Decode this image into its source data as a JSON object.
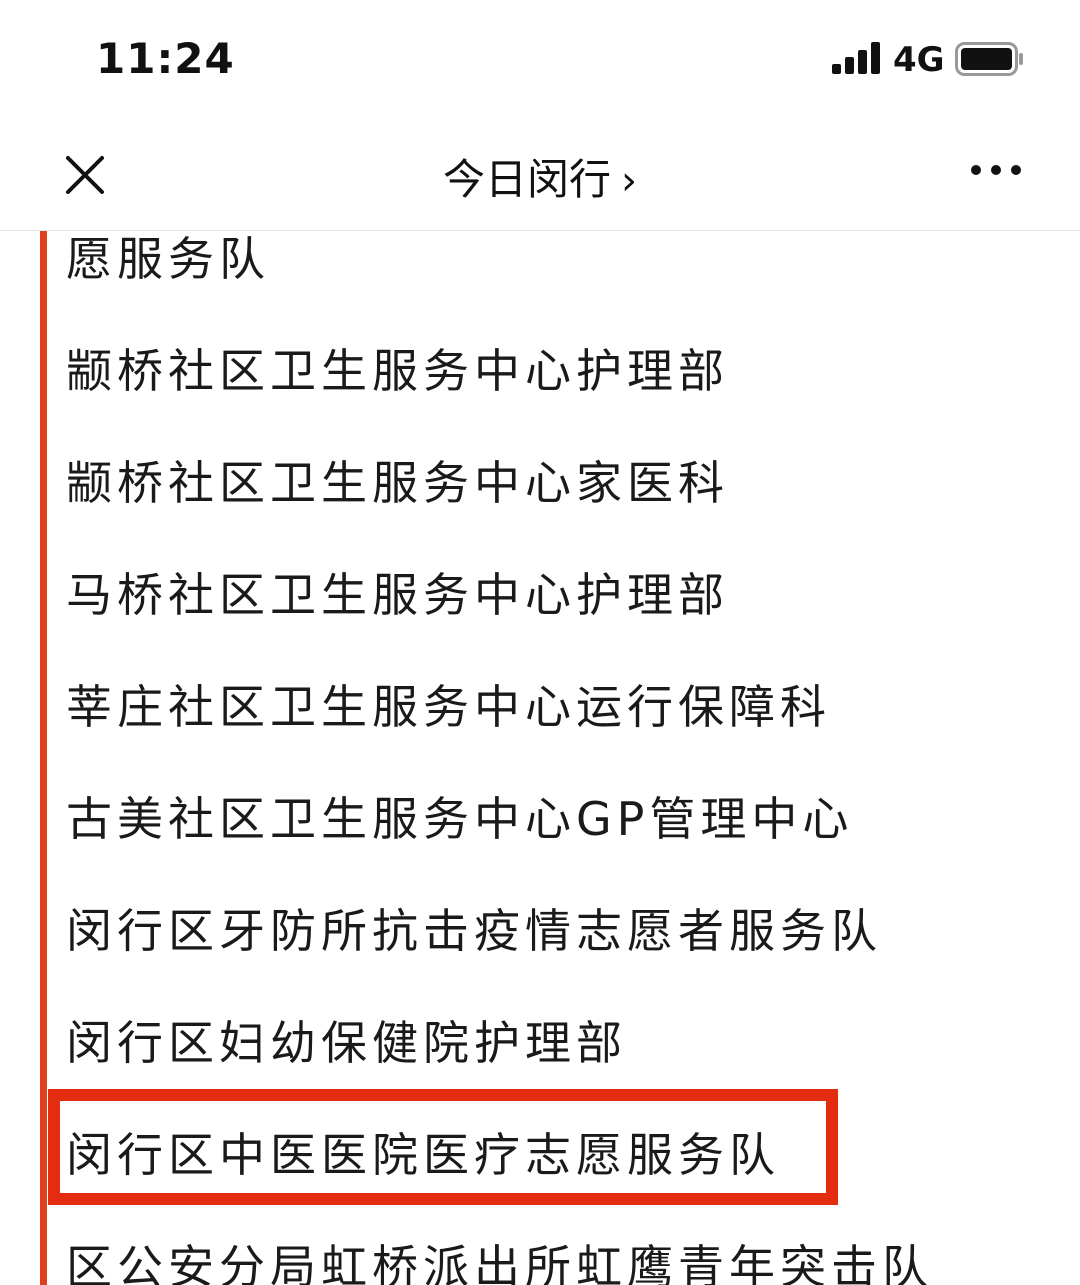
{
  "status_bar": {
    "time": "11:24",
    "network": "4G",
    "signal_icon": "signal-bars-icon",
    "battery_icon": "battery-icon"
  },
  "nav": {
    "title": "今日闵行",
    "chevron": "›",
    "close_icon": "close-icon",
    "more_icon": "more-dots-icon"
  },
  "list": {
    "items": [
      "愿服务队",
      "颛桥社区卫生服务中心护理部",
      "颛桥社区卫生服务中心家医科",
      "马桥社区卫生服务中心护理部",
      "莘庄社区卫生服务中心运行保障科",
      "古美社区卫生服务中心GP管理中心",
      "闵行区牙防所抗击疫情志愿者服务队",
      "闵行区妇幼保健院护理部",
      "闵行区中医医院医疗志愿服务队",
      "区公安分局虹桥派出所虹鹰青年突击队"
    ]
  },
  "colors": {
    "timeline": "#e0401e",
    "highlight": "#e32c10"
  }
}
